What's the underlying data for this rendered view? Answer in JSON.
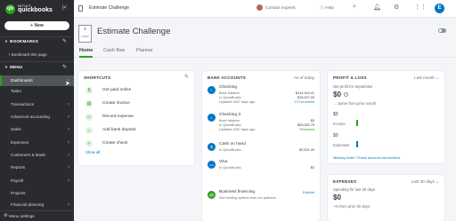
{
  "brand": {
    "intuit": "INTUIT",
    "name": "quickbooks",
    "badge": "qb"
  },
  "sidebar": {
    "new_label": "+ New",
    "bookmarks_heading": "BOOKMARKS",
    "bookmark_link": "+ Bookmark this page",
    "menu_heading": "MENU",
    "items": [
      {
        "label": "Dashboards"
      },
      {
        "label": "Tasks"
      },
      {
        "label": "Transactions"
      },
      {
        "label": "Advanced accounting"
      },
      {
        "label": "Sales"
      },
      {
        "label": "Expenses"
      },
      {
        "label": "Customers & leads"
      },
      {
        "label": "Reports"
      },
      {
        "label": "Payroll"
      },
      {
        "label": "Projects"
      },
      {
        "label": "Financial planning"
      }
    ],
    "menu_settings": "Menu settings"
  },
  "topbar": {
    "title": "Estimate Challenge",
    "contact": "Contact experts",
    "help": "Help",
    "avatar_initial": "E"
  },
  "company": {
    "logo_text": "LOGO",
    "name": "Estimate Challenge"
  },
  "tabs": [
    "Home",
    "Cash flow",
    "Planner"
  ],
  "shortcuts": {
    "title": "SHORTCUTS",
    "items": [
      "Get paid online",
      "Create invoice",
      "Record expense",
      "Add bank deposit",
      "Create check"
    ],
    "show_all": "Show all"
  },
  "bank": {
    "title": "BANK ACCOUNTS",
    "as_of": "As of today",
    "accounts": [
      {
        "name": "Checking",
        "bank_label": "Bank balance",
        "bank_value": "$414,344.41",
        "qb_label": "In QuickBooks",
        "qb_value": "$15,007.00",
        "updated": "Updated 1657 days ago",
        "action": "272 to review"
      },
      {
        "name": "Checking 3",
        "bank_label": "Bank balance",
        "bank_value": "$0",
        "qb_label": "In QuickBooks",
        "qb_value": "$25,052.75",
        "updated": "Updated 1657 days ago",
        "action": "Reviewed"
      },
      {
        "name": "Cash on hand",
        "qb_label": "In QuickBooks",
        "qb_value": "$2,521.00"
      },
      {
        "name": "Visa",
        "qb_label": "In QuickBooks",
        "qb_value": "$0"
      },
      {
        "name": "Business financing",
        "sub": "See funding options from our partners",
        "action": "Explore"
      }
    ]
  },
  "pl": {
    "title": "PROFIT & LOSS",
    "period": "Last month",
    "net_label": "Net profit for September",
    "net_value": "$0",
    "change": "Same from prior month",
    "income_value": "$0",
    "income_label": "Income",
    "expenses_value": "$0",
    "expenses_label": "Expenses",
    "missing": "Missing Data? Check account connections"
  },
  "expenses": {
    "title": "EXPENSES",
    "period": "Last 30 days",
    "label": "Spending for last 30 days",
    "value": "$0",
    "change": "~% from prior 30 days"
  },
  "colors": {
    "accent": "#2ca01c",
    "link": "#0077c5",
    "sidebar": "#2a2b2e"
  }
}
